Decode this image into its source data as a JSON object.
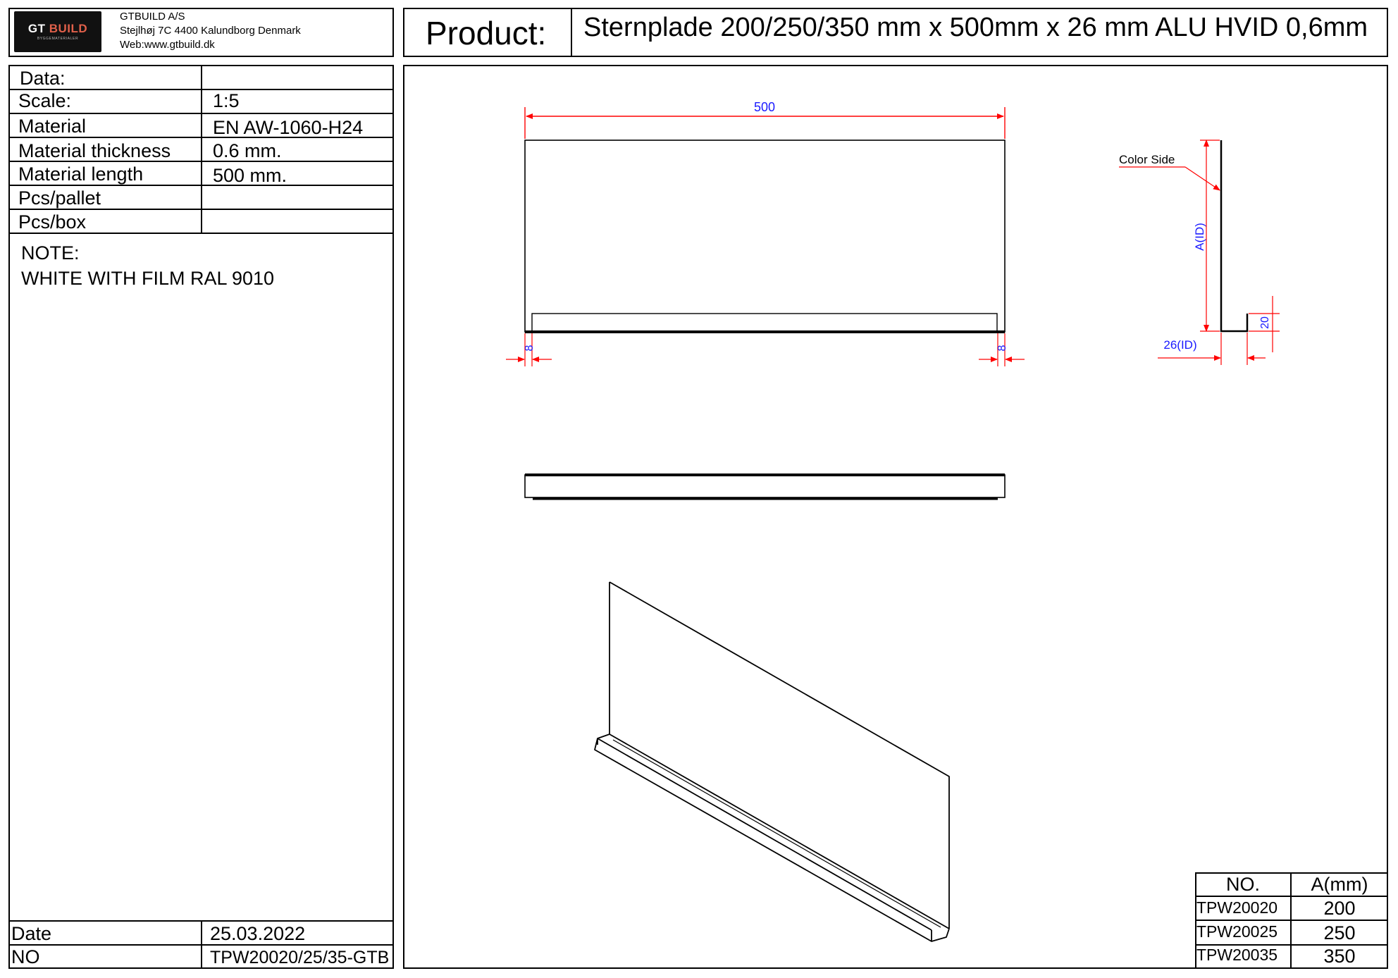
{
  "header": {
    "logo_text_gt": "GT",
    "logo_text_build": "BUILD",
    "logo_subtext": "BYGGEMATERIALER",
    "company_name": "GTBUILD A/S",
    "company_address": "Stejlhøj 7C 4400 Kalundborg Denmark",
    "company_web": "Web:www.gtbuild.dk",
    "product_label": "Product:",
    "product_value": "Sternplade 200/250/350 mm x 500mm x 26 mm ALU HVID 0,6mm"
  },
  "spec_table": [
    {
      "label": "Data:",
      "value": ""
    },
    {
      "label": "Scale:",
      "value": "1:5"
    },
    {
      "label": "Material",
      "value": "EN AW-1060-H24"
    },
    {
      "label": "Material thickness",
      "value": "0.6 mm."
    },
    {
      "label": "Material length",
      "value": "500 mm."
    },
    {
      "label": "Pcs/pallet",
      "value": ""
    },
    {
      "label": "Pcs/box",
      "value": ""
    }
  ],
  "note": {
    "title": "NOTE:",
    "text": "WHITE WITH FILM RAL 9010"
  },
  "footer": {
    "date_label": "Date",
    "date_value": "25.03.2022",
    "no_label": "NO",
    "no_value": "TPW20020/25/35-GTB"
  },
  "drawing": {
    "dim_length": "500",
    "dim_left_inset": "8",
    "dim_right_inset": "8",
    "profile_callout": "Color Side",
    "dim_height": "A(ID)",
    "dim_flange": "20",
    "dim_depth": "26(ID)",
    "colors": {
      "dimension_line": "#ff0000",
      "dimension_text": "#1a1aff",
      "outline": "#000000"
    }
  },
  "variants_table": {
    "headers": [
      "NO.",
      "A(mm)"
    ],
    "rows": [
      [
        "TPW20020",
        "200"
      ],
      [
        "TPW20025",
        "250"
      ],
      [
        "TPW20035",
        "350"
      ]
    ]
  }
}
